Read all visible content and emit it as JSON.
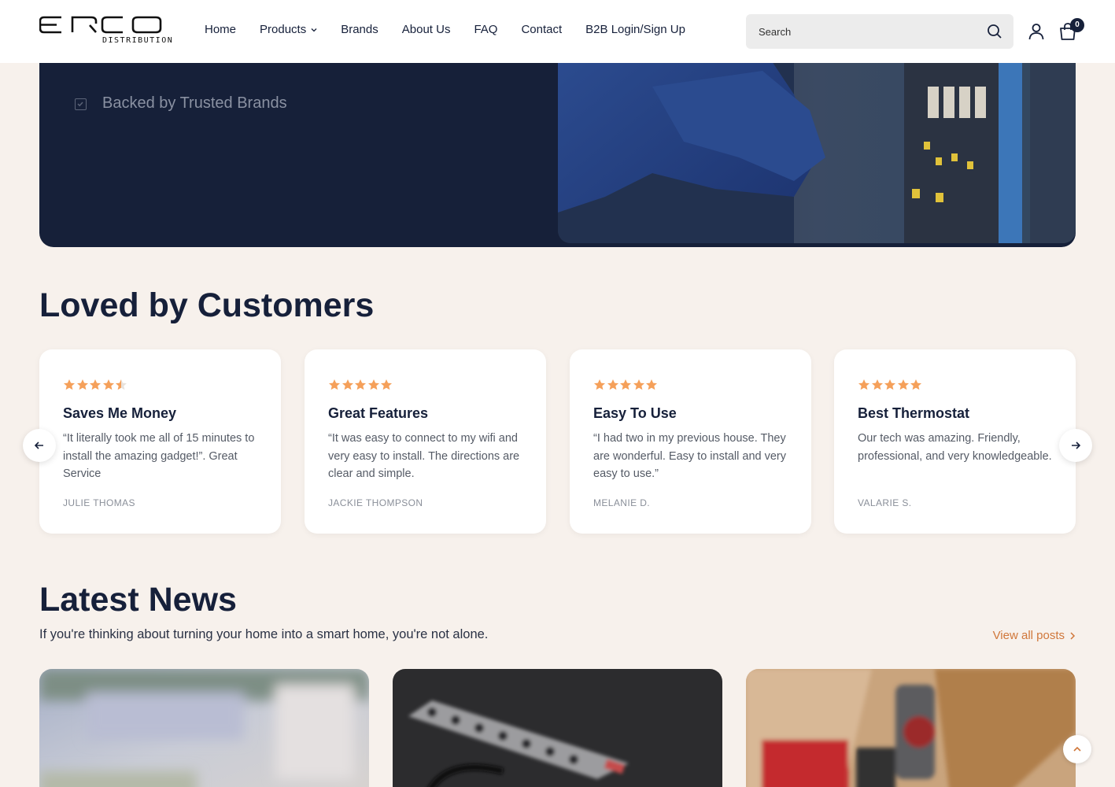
{
  "header": {
    "logo_text": "ERCO",
    "logo_subtitle": "DISTRIBUTION",
    "nav": [
      {
        "label": "Home"
      },
      {
        "label": "Products"
      },
      {
        "label": "Brands"
      },
      {
        "label": "About Us"
      },
      {
        "label": "FAQ"
      },
      {
        "label": "Contact"
      },
      {
        "label": "B2B Login/Sign Up"
      }
    ],
    "search_placeholder": "Search",
    "cart_count": "0"
  },
  "hero": {
    "feature_text": "Backed by Trusted Brands"
  },
  "reviews": {
    "heading": "Loved by Customers",
    "items": [
      {
        "rating": 4.5,
        "title": "Saves Me Money",
        "quote": "“It literally took me all of 15 minutes to install the amazing gadget!”. Great Service",
        "author": "JULIE THOMAS"
      },
      {
        "rating": 5,
        "title": "Great Features",
        "quote": "“It was easy to connect to my wifi and very easy to install. The directions are clear and simple.",
        "author": "JACKIE THOMPSON"
      },
      {
        "rating": 5,
        "title": "Easy To Use",
        "quote": "“I had two in my previous house. They are wonderful. Easy to install and very easy to use.”",
        "author": "MELANIE D."
      },
      {
        "rating": 5,
        "title": "Best Thermostat",
        "quote": "Our tech was amazing. Friendly, professional, and very knowledgeable.",
        "author": "VALARIE S."
      }
    ]
  },
  "news": {
    "heading": "Latest News",
    "subtitle": "If you're thinking about turning your home into a smart home, you're not alone.",
    "view_all_label": "View all posts"
  },
  "colors": {
    "navy": "#16203a",
    "page_bg": "#f7f1ec",
    "star": "#f5a05a",
    "accent": "#d0773a"
  }
}
